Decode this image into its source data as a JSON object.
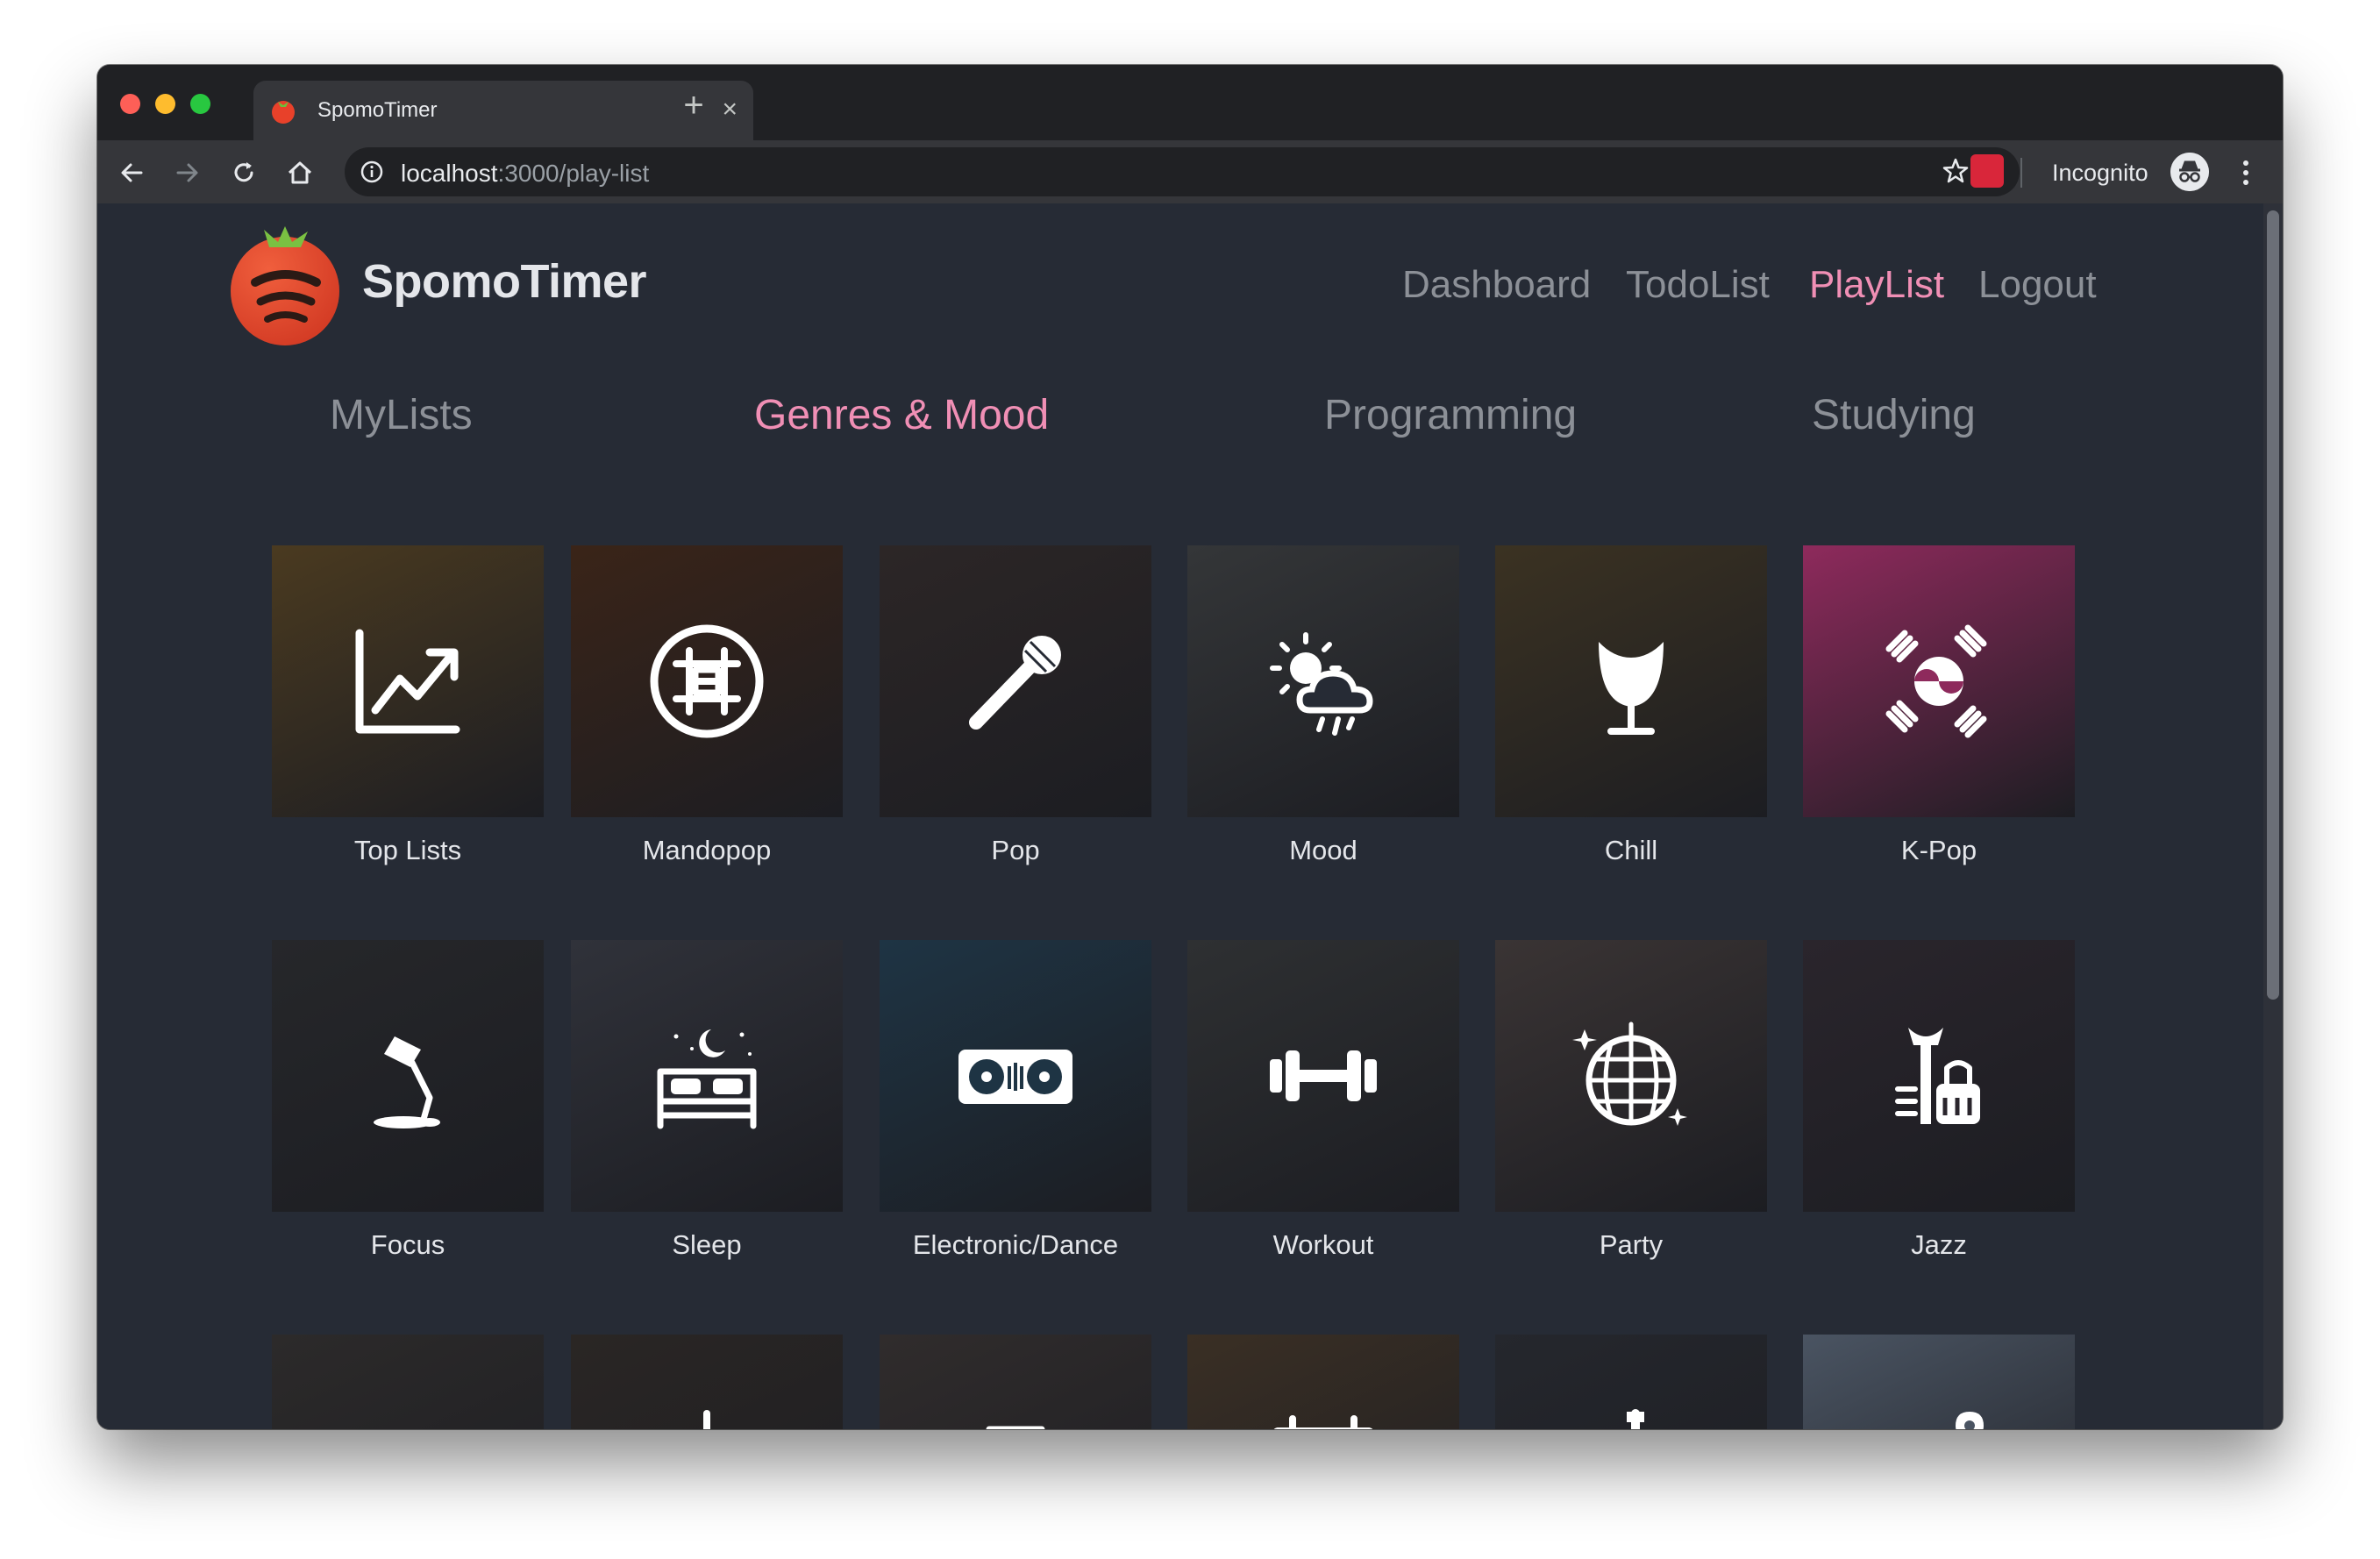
{
  "browser": {
    "tab_title": "SpomoTimer",
    "tab_close": "×",
    "new_tab": "+",
    "url_host": "localhost",
    "url_path": ":3000/play-list",
    "incognito_label": "Incognito"
  },
  "app": {
    "brand": "SpomoTimer",
    "nav": [
      {
        "label": "Dashboard",
        "active": false
      },
      {
        "label": "TodoList",
        "active": false
      },
      {
        "label": "PlayList",
        "active": true
      },
      {
        "label": "Logout",
        "active": false
      }
    ],
    "categories": [
      {
        "label": "MyLists",
        "active": false
      },
      {
        "label": "Genres & Mood",
        "active": true
      },
      {
        "label": "Programming",
        "active": false
      },
      {
        "label": "Studying",
        "active": false
      }
    ],
    "tiles": [
      {
        "label": "Top Lists",
        "icon": "chart-icon",
        "bg": "#4a3a20"
      },
      {
        "label": "Mandopop",
        "icon": "chinese-symbol-icon",
        "bg": "#3a2418"
      },
      {
        "label": "Pop",
        "icon": "microphone-icon",
        "bg": "#2c2626"
      },
      {
        "label": "Mood",
        "icon": "weather-icon",
        "bg": "#343638"
      },
      {
        "label": "Chill",
        "icon": "egg-chair-icon",
        "bg": "#3b3222"
      },
      {
        "label": "K-Pop",
        "icon": "korean-flag-icon",
        "bg": "#8e2a5c"
      },
      {
        "label": "Focus",
        "icon": "desk-lamp-icon",
        "bg": "#26272a"
      },
      {
        "label": "Sleep",
        "icon": "bed-icon",
        "bg": "#30323a"
      },
      {
        "label": "Electronic/Dance",
        "icon": "dj-deck-icon",
        "bg": "#1e3444"
      },
      {
        "label": "Workout",
        "icon": "dumbbell-icon",
        "bg": "#2e3032"
      },
      {
        "label": "Party",
        "icon": "disco-ball-icon",
        "bg": "#3a3434"
      },
      {
        "label": "Jazz",
        "icon": "jazz-instruments-icon",
        "bg": "#2a252c"
      },
      {
        "label": "",
        "icon": "heart-icon",
        "bg": "#2c2a2a"
      },
      {
        "label": "",
        "icon": "violin-icon",
        "bg": "#2a2624"
      },
      {
        "label": "",
        "icon": "boombox-icon",
        "bg": "#302c2c"
      },
      {
        "label": "",
        "icon": "eighties-calendar-icon",
        "bg": "#3a2f24"
      },
      {
        "label": "",
        "icon": "electric-guitar-icon",
        "bg": "#25272d"
      },
      {
        "label": "",
        "icon": "map-pin-icon",
        "bg": "#4a5462"
      }
    ]
  },
  "colors": {
    "page_bg": "#262b35",
    "accent_pink": "#f08fb5",
    "muted_text": "#8c9097",
    "brand_text": "#e4e6ea"
  }
}
